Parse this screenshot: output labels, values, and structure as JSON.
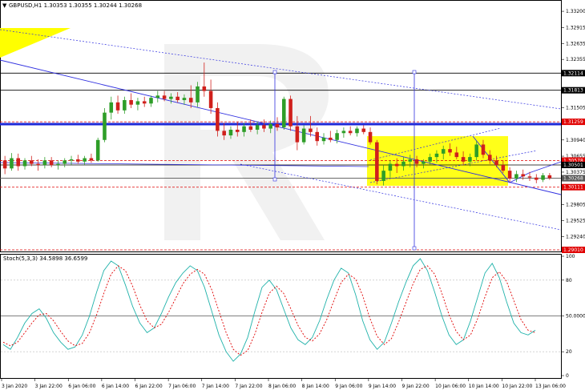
{
  "chart_data": {
    "type": "candlestick",
    "title": "GBPUSD,H1  1.30353 1.30355 1.30244 1.30268",
    "colors": {
      "bull": "#2e9e28",
      "bear": "#d0201c",
      "axis": "#000000",
      "grid_dot": "#d8d8d8",
      "channel": "#3030e0",
      "highlight": "#ffff00",
      "support": "#e00000",
      "stoch_main": "#20b2aa",
      "stoch_signal": "#e00000"
    },
    "price_axis": {
      "min": 1.2901,
      "max": 1.3337,
      "ticks": [
        "1.33200",
        "1.32915",
        "1.32635",
        "1.32355",
        "1.31505",
        "1.30940",
        "1.30655",
        "1.30375",
        "1.29805",
        "1.29525",
        "1.29240"
      ]
    },
    "time_labels": [
      "3 Jan 2020",
      "3 Jan 22:00",
      "6 Jan 06:00",
      "6 Jan 14:00",
      "6 Jan 22:00",
      "7 Jan 06:00",
      "7 Jan 14:00",
      "7 Jan 22:00",
      "8 Jan 06:00",
      "8 Jan 14:00",
      "9 Jan 06:00",
      "9 Jan 14:00",
      "9 Jan 22:00",
      "10 Jan 06:00",
      "10 Jan 14:00",
      "10 Jan 22:00",
      "13 Jan 06:00"
    ],
    "horizontal_levels": [
      {
        "label": "1.32114",
        "value": 1.32114,
        "color": "#000000",
        "style": "solid"
      },
      {
        "label": "1.31813",
        "value": 1.31813,
        "color": "#000000",
        "style": "solid"
      },
      {
        "label": "1.31259",
        "value": 1.31259,
        "color": "#e00000",
        "style": "dashed"
      },
      {
        "label": "1.30578",
        "value": 1.30578,
        "color": "#e00000",
        "style": "dashed"
      },
      {
        "label": "1.30501",
        "value": 1.30501,
        "color": "#000000",
        "style": "solid"
      },
      {
        "label": "1.30268",
        "value": 1.30268,
        "color": "#555555",
        "style": "solid"
      },
      {
        "label": "1.30111",
        "value": 1.30111,
        "color": "#e00000",
        "style": "dashed"
      },
      {
        "label": "1.29010",
        "value": 1.2901,
        "color": "#e00000",
        "style": "dashed"
      }
    ],
    "ohlc_candles": [
      [
        1.3058,
        1.3066,
        1.3034,
        1.3044
      ],
      [
        1.3044,
        1.3071,
        1.304,
        1.3062
      ],
      [
        1.3062,
        1.307,
        1.304,
        1.3048
      ],
      [
        1.3048,
        1.3062,
        1.3042,
        1.3058
      ],
      [
        1.3058,
        1.3066,
        1.3048,
        1.3052
      ],
      [
        1.3052,
        1.306,
        1.304,
        1.305
      ],
      [
        1.305,
        1.3064,
        1.3044,
        1.3058
      ],
      [
        1.3058,
        1.3064,
        1.3046,
        1.305
      ],
      [
        1.305,
        1.3058,
        1.3042,
        1.3052
      ],
      [
        1.3052,
        1.3062,
        1.3046,
        1.3058
      ],
      [
        1.3058,
        1.3066,
        1.305,
        1.306
      ],
      [
        1.306,
        1.3068,
        1.3052,
        1.3056
      ],
      [
        1.3056,
        1.3066,
        1.305,
        1.3062
      ],
      [
        1.3062,
        1.307,
        1.3054,
        1.3058
      ],
      [
        1.3058,
        1.3098,
        1.3056,
        1.3094
      ],
      [
        1.3094,
        1.315,
        1.309,
        1.3142
      ],
      [
        1.3142,
        1.317,
        1.313,
        1.316
      ],
      [
        1.316,
        1.3172,
        1.314,
        1.3146
      ],
      [
        1.3146,
        1.317,
        1.314,
        1.3164
      ],
      [
        1.3164,
        1.3176,
        1.315,
        1.3156
      ],
      [
        1.3156,
        1.3168,
        1.3146,
        1.3162
      ],
      [
        1.3162,
        1.317,
        1.3152,
        1.3158
      ],
      [
        1.3158,
        1.3172,
        1.3152,
        1.3168
      ],
      [
        1.3168,
        1.318,
        1.316,
        1.3172
      ],
      [
        1.3172,
        1.318,
        1.3162,
        1.3166
      ],
      [
        1.3166,
        1.3176,
        1.3158,
        1.317
      ],
      [
        1.317,
        1.3178,
        1.316,
        1.3164
      ],
      [
        1.3164,
        1.3174,
        1.3156,
        1.3168
      ],
      [
        1.3168,
        1.319,
        1.315,
        1.316
      ],
      [
        1.316,
        1.3196,
        1.3152,
        1.3188
      ],
      [
        1.3188,
        1.323,
        1.317,
        1.318
      ],
      [
        1.318,
        1.32,
        1.314,
        1.315
      ],
      [
        1.315,
        1.316,
        1.31,
        1.311
      ],
      [
        1.311,
        1.3124,
        1.3094,
        1.3102
      ],
      [
        1.3102,
        1.3118,
        1.3096,
        1.3112
      ],
      [
        1.3112,
        1.3126,
        1.31,
        1.3108
      ],
      [
        1.3108,
        1.3124,
        1.31,
        1.3118
      ],
      [
        1.3118,
        1.313,
        1.3108,
        1.3112
      ],
      [
        1.3112,
        1.3126,
        1.3104,
        1.312
      ],
      [
        1.312,
        1.313,
        1.3108,
        1.3114
      ],
      [
        1.3114,
        1.3128,
        1.3106,
        1.3122
      ],
      [
        1.3122,
        1.3134,
        1.311,
        1.3116
      ],
      [
        1.3116,
        1.317,
        1.3112,
        1.3166
      ],
      [
        1.3166,
        1.3172,
        1.311,
        1.3118
      ],
      [
        1.3118,
        1.3136,
        1.3076,
        1.309
      ],
      [
        1.309,
        1.312,
        1.3086,
        1.3114
      ],
      [
        1.3114,
        1.3136,
        1.31,
        1.3108
      ],
      [
        1.3108,
        1.3116,
        1.3084,
        1.3092
      ],
      [
        1.3092,
        1.3106,
        1.3086,
        1.3098
      ],
      [
        1.3098,
        1.311,
        1.309,
        1.3094
      ],
      [
        1.3094,
        1.3112,
        1.3088,
        1.3106
      ],
      [
        1.3106,
        1.3116,
        1.3098,
        1.311
      ],
      [
        1.311,
        1.3118,
        1.3102,
        1.3106
      ],
      [
        1.3106,
        1.3118,
        1.31,
        1.3114
      ],
      [
        1.3114,
        1.312,
        1.3104,
        1.3108
      ],
      [
        1.3108,
        1.3116,
        1.3086,
        1.309
      ],
      [
        1.309,
        1.3094,
        1.3016,
        1.3022
      ],
      [
        1.3022,
        1.305,
        1.3014,
        1.304
      ],
      [
        1.304,
        1.3058,
        1.3028,
        1.3052
      ],
      [
        1.3052,
        1.3062,
        1.3036,
        1.3048
      ],
      [
        1.3048,
        1.3064,
        1.304,
        1.3056
      ],
      [
        1.3056,
        1.3068,
        1.3046,
        1.306
      ],
      [
        1.306,
        1.3066,
        1.3046,
        1.3052
      ],
      [
        1.3052,
        1.306,
        1.3044,
        1.3056
      ],
      [
        1.3056,
        1.307,
        1.305,
        1.3064
      ],
      [
        1.3064,
        1.3076,
        1.3054,
        1.307
      ],
      [
        1.307,
        1.3084,
        1.306,
        1.3078
      ],
      [
        1.3078,
        1.3088,
        1.3066,
        1.3072
      ],
      [
        1.3072,
        1.3082,
        1.306,
        1.3064
      ],
      [
        1.3064,
        1.3074,
        1.305,
        1.3056
      ],
      [
        1.3056,
        1.307,
        1.3048,
        1.3064
      ],
      [
        1.3064,
        1.3092,
        1.3058,
        1.3086
      ],
      [
        1.3086,
        1.3094,
        1.3062,
        1.3068
      ],
      [
        1.3068,
        1.3076,
        1.3052,
        1.3058
      ],
      [
        1.3058,
        1.3066,
        1.3046,
        1.305
      ],
      [
        1.305,
        1.3058,
        1.3036,
        1.304
      ],
      [
        1.304,
        1.3046,
        1.302,
        1.3026
      ],
      [
        1.3026,
        1.304,
        1.302,
        1.3034
      ],
      [
        1.3034,
        1.3042,
        1.3024,
        1.303
      ],
      [
        1.303,
        1.3038,
        1.3022,
        1.3028
      ],
      [
        1.3028,
        1.3034,
        1.3018,
        1.3024
      ],
      [
        1.3024,
        1.3036,
        1.302,
        1.3032
      ],
      [
        1.3032,
        1.3036,
        1.3024,
        1.3027
      ]
    ],
    "stochastic": {
      "label": "Stoch(5,3,3) 34.5898 36.6599",
      "ymin": 0,
      "ymax": 100,
      "ticks": [
        "100",
        "80",
        "50.0000",
        "20",
        "0"
      ],
      "levels": [
        80,
        50,
        20
      ],
      "main": [
        26,
        22,
        32,
        44,
        52,
        56,
        48,
        36,
        28,
        22,
        24,
        34,
        50,
        70,
        88,
        96,
        92,
        76,
        58,
        44,
        36,
        40,
        52,
        66,
        78,
        86,
        92,
        88,
        74,
        54,
        34,
        20,
        12,
        18,
        32,
        54,
        74,
        80,
        72,
        56,
        40,
        30,
        26,
        32,
        46,
        64,
        80,
        90,
        86,
        68,
        46,
        30,
        22,
        28,
        44,
        62,
        78,
        92,
        98,
        88,
        70,
        50,
        34,
        26,
        30,
        46,
        66,
        86,
        94,
        82,
        62,
        44,
        36,
        34,
        38
      ],
      "signal": [
        28,
        25,
        28,
        36,
        44,
        51,
        52,
        46,
        37,
        29,
        25,
        27,
        36,
        51,
        69,
        85,
        92,
        88,
        75,
        59,
        46,
        40,
        43,
        53,
        65,
        77,
        85,
        89,
        85,
        72,
        54,
        36,
        22,
        17,
        21,
        35,
        53,
        69,
        75,
        69,
        56,
        42,
        32,
        29,
        35,
        47,
        63,
        78,
        85,
        81,
        67,
        48,
        33,
        26,
        31,
        45,
        61,
        77,
        89,
        92,
        85,
        69,
        51,
        37,
        30,
        34,
        48,
        66,
        82,
        87,
        79,
        63,
        47,
        38,
        36
      ]
    }
  }
}
